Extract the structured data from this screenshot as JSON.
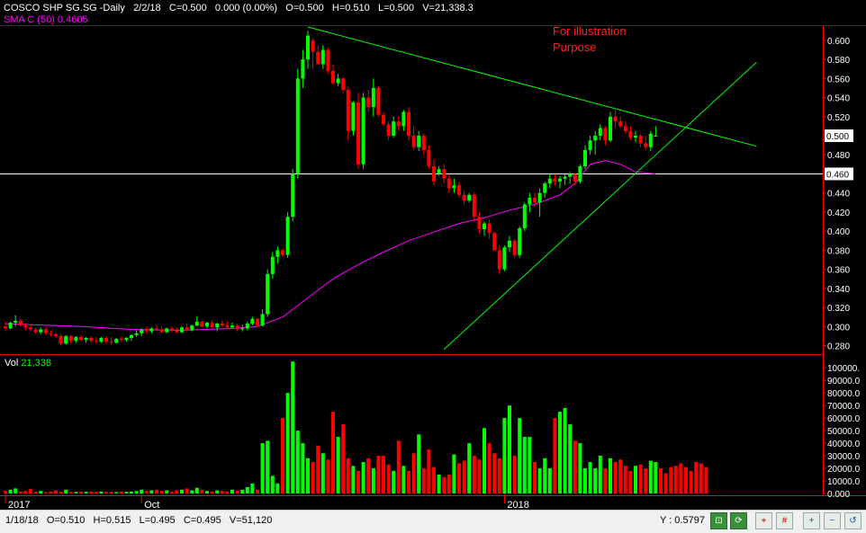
{
  "header": {
    "symbol": "COSCO SHP SG.SG -Daily",
    "date": "2/2/18",
    "close": "C=0.500",
    "change": "0.000 (0.00%)",
    "open": "O=0.500",
    "high": "H=0.510",
    "low": "L=0.500",
    "volume": "V=21,338.3"
  },
  "sma_label": "SMA C (50) 0.4605",
  "note": {
    "line1": "For illustration",
    "line2": "Purpose"
  },
  "volume_panel": {
    "label": "Vol",
    "value": "21,338"
  },
  "status": {
    "info": "1/18/18   O=0.510   H=0.515   L=0.495   C=0.495   V=51,120",
    "y_readout": "Y : 0.5797"
  },
  "colors": {
    "up": "#00ff00",
    "down": "#ff0000",
    "sma": "#ff00ff",
    "trendline": "#00ff00",
    "axis": "#ff0000",
    "hline": "#ffffff",
    "background": "#000000"
  },
  "toolbar_icons": [
    "zoom-fit-icon",
    "refresh-icon",
    "crosshair-icon",
    "grid-icon",
    "zoom-in-icon",
    "zoom-out-icon",
    "reset-icon"
  ],
  "chart_data": [
    {
      "type": "candlestick",
      "title": "COSCO SHP SG.SG -Daily",
      "price_axis_ticks": [
        "0.600",
        "0.580",
        "0.560",
        "0.540",
        "0.520",
        "0.500",
        "0.480",
        "0.460",
        "0.440",
        "0.420",
        "0.400",
        "0.380",
        "0.360",
        "0.340",
        "0.320",
        "0.300",
        "0.280"
      ],
      "ylim": [
        0.272,
        0.614
      ],
      "last_price_tag": "0.500",
      "hline_tag": "0.460",
      "hline_value": 0.46,
      "x_ticks": [
        {
          "i": 0,
          "label": "2017"
        },
        {
          "i": 27,
          "label": "Oct"
        },
        {
          "i": 99,
          "label": "2018"
        }
      ],
      "candles": [
        [
          0.3,
          0.305,
          0.295,
          0.298
        ],
        [
          0.298,
          0.305,
          0.297,
          0.304
        ],
        [
          0.304,
          0.312,
          0.3,
          0.306
        ],
        [
          0.306,
          0.308,
          0.3,
          0.301
        ],
        [
          0.301,
          0.303,
          0.296,
          0.299
        ],
        [
          0.299,
          0.302,
          0.295,
          0.297
        ],
        [
          0.297,
          0.299,
          0.292,
          0.294
        ],
        [
          0.294,
          0.299,
          0.292,
          0.297
        ],
        [
          0.297,
          0.299,
          0.291,
          0.293
        ],
        [
          0.293,
          0.296,
          0.29,
          0.292
        ],
        [
          0.292,
          0.293,
          0.288,
          0.29
        ],
        [
          0.29,
          0.292,
          0.28,
          0.282
        ],
        [
          0.282,
          0.291,
          0.281,
          0.29
        ],
        [
          0.29,
          0.291,
          0.282,
          0.285
        ],
        [
          0.285,
          0.29,
          0.283,
          0.289
        ],
        [
          0.289,
          0.291,
          0.284,
          0.286
        ],
        [
          0.286,
          0.289,
          0.283,
          0.288
        ],
        [
          0.288,
          0.29,
          0.283,
          0.285
        ],
        [
          0.285,
          0.289,
          0.282,
          0.284
        ],
        [
          0.284,
          0.289,
          0.283,
          0.288
        ],
        [
          0.288,
          0.29,
          0.282,
          0.284
        ],
        [
          0.284,
          0.289,
          0.281,
          0.283
        ],
        [
          0.283,
          0.288,
          0.282,
          0.287
        ],
        [
          0.287,
          0.29,
          0.284,
          0.286
        ],
        [
          0.286,
          0.289,
          0.284,
          0.288
        ],
        [
          0.288,
          0.292,
          0.285,
          0.291
        ],
        [
          0.291,
          0.296,
          0.289,
          0.293
        ],
        [
          0.293,
          0.298,
          0.29,
          0.297
        ],
        [
          0.297,
          0.3,
          0.292,
          0.295
        ],
        [
          0.295,
          0.299,
          0.293,
          0.298
        ],
        [
          0.298,
          0.302,
          0.295,
          0.297
        ],
        [
          0.297,
          0.3,
          0.293,
          0.294
        ],
        [
          0.294,
          0.299,
          0.293,
          0.298
        ],
        [
          0.298,
          0.3,
          0.294,
          0.296
        ],
        [
          0.296,
          0.299,
          0.293,
          0.294
        ],
        [
          0.294,
          0.3,
          0.293,
          0.299
        ],
        [
          0.299,
          0.303,
          0.295,
          0.296
        ],
        [
          0.296,
          0.302,
          0.295,
          0.301
        ],
        [
          0.301,
          0.311,
          0.3,
          0.305
        ],
        [
          0.305,
          0.306,
          0.299,
          0.3
        ],
        [
          0.3,
          0.305,
          0.298,
          0.304
        ],
        [
          0.304,
          0.307,
          0.298,
          0.299
        ],
        [
          0.299,
          0.304,
          0.295,
          0.303
        ],
        [
          0.303,
          0.306,
          0.299,
          0.301
        ],
        [
          0.301,
          0.305,
          0.297,
          0.299
        ],
        [
          0.299,
          0.304,
          0.298,
          0.301
        ],
        [
          0.301,
          0.303,
          0.295,
          0.297
        ],
        [
          0.297,
          0.302,
          0.295,
          0.298
        ],
        [
          0.298,
          0.305,
          0.296,
          0.303
        ],
        [
          0.303,
          0.31,
          0.301,
          0.308
        ],
        [
          0.308,
          0.309,
          0.299,
          0.301
        ],
        [
          0.301,
          0.318,
          0.3,
          0.313
        ],
        [
          0.313,
          0.36,
          0.31,
          0.355
        ],
        [
          0.355,
          0.378,
          0.35,
          0.373
        ],
        [
          0.373,
          0.384,
          0.366,
          0.38
        ],
        [
          0.38,
          0.382,
          0.373,
          0.375
        ],
        [
          0.375,
          0.42,
          0.372,
          0.415
        ],
        [
          0.415,
          0.465,
          0.41,
          0.46
        ],
        [
          0.46,
          0.57,
          0.455,
          0.56
        ],
        [
          0.56,
          0.59,
          0.55,
          0.58
        ],
        [
          0.58,
          0.61,
          0.57,
          0.605
        ],
        [
          0.6,
          0.603,
          0.57,
          0.588
        ],
        [
          0.588,
          0.594,
          0.575,
          0.575
        ],
        [
          0.575,
          0.595,
          0.57,
          0.59
        ],
        [
          0.59,
          0.592,
          0.565,
          0.568
        ],
        [
          0.568,
          0.575,
          0.553,
          0.555
        ],
        [
          0.555,
          0.565,
          0.552,
          0.56
        ],
        [
          0.56,
          0.562,
          0.545,
          0.548
        ],
        [
          0.548,
          0.551,
          0.495,
          0.505
        ],
        [
          0.505,
          0.536,
          0.5,
          0.535
        ],
        [
          0.535,
          0.545,
          0.465,
          0.47
        ],
        [
          0.47,
          0.545,
          0.465,
          0.54
        ],
        [
          0.54,
          0.548,
          0.525,
          0.53
        ],
        [
          0.53,
          0.56,
          0.52,
          0.55
        ],
        [
          0.55,
          0.552,
          0.52,
          0.522
        ],
        [
          0.522,
          0.525,
          0.51,
          0.512
        ],
        [
          0.512,
          0.515,
          0.495,
          0.5
        ],
        [
          0.5,
          0.52,
          0.498,
          0.515
        ],
        [
          0.515,
          0.52,
          0.505,
          0.51
        ],
        [
          0.51,
          0.527,
          0.505,
          0.525
        ],
        [
          0.525,
          0.53,
          0.495,
          0.5
        ],
        [
          0.5,
          0.51,
          0.485,
          0.488
        ],
        [
          0.488,
          0.505,
          0.484,
          0.5
        ],
        [
          0.5,
          0.502,
          0.48,
          0.485
        ],
        [
          0.485,
          0.49,
          0.465,
          0.468
        ],
        [
          0.468,
          0.475,
          0.448,
          0.452
        ],
        [
          0.46,
          0.468,
          0.458,
          0.465
        ],
        [
          0.465,
          0.47,
          0.45,
          0.455
        ],
        [
          0.455,
          0.46,
          0.44,
          0.445
        ],
        [
          0.445,
          0.455,
          0.44,
          0.448
        ],
        [
          0.448,
          0.452,
          0.435,
          0.438
        ],
        [
          0.438,
          0.442,
          0.428,
          0.432
        ],
        [
          0.432,
          0.44,
          0.43,
          0.438
        ],
        [
          0.438,
          0.44,
          0.41,
          0.415
        ],
        [
          0.415,
          0.42,
          0.398,
          0.402
        ],
        [
          0.402,
          0.41,
          0.395,
          0.408
        ],
        [
          0.408,
          0.412,
          0.392,
          0.398
        ],
        [
          0.398,
          0.4,
          0.378,
          0.38
        ],
        [
          0.38,
          0.385,
          0.355,
          0.36
        ],
        [
          0.36,
          0.385,
          0.358,
          0.383
        ],
        [
          0.383,
          0.395,
          0.378,
          0.39
        ],
        [
          0.39,
          0.392,
          0.372,
          0.375
        ],
        [
          0.375,
          0.405,
          0.372,
          0.403
        ],
        [
          0.403,
          0.43,
          0.4,
          0.428
        ],
        [
          0.428,
          0.44,
          0.42,
          0.435
        ],
        [
          0.435,
          0.44,
          0.425,
          0.43
        ],
        [
          0.43,
          0.445,
          0.415,
          0.44
        ],
        [
          0.44,
          0.452,
          0.435,
          0.45
        ],
        [
          0.45,
          0.46,
          0.445,
          0.455
        ],
        [
          0.455,
          0.46,
          0.448,
          0.452
        ],
        [
          0.452,
          0.458,
          0.445,
          0.455
        ],
        [
          0.455,
          0.46,
          0.448,
          0.457
        ],
        [
          0.457,
          0.462,
          0.45,
          0.46
        ],
        [
          0.46,
          0.46,
          0.448,
          0.452
        ],
        [
          0.452,
          0.47,
          0.45,
          0.468
        ],
        [
          0.468,
          0.49,
          0.465,
          0.485
        ],
        [
          0.485,
          0.5,
          0.48,
          0.495
        ],
        [
          0.495,
          0.505,
          0.48,
          0.5
        ],
        [
          0.5,
          0.512,
          0.495,
          0.508
        ],
        [
          0.508,
          0.51,
          0.49,
          0.495
        ],
        [
          0.495,
          0.525,
          0.493,
          0.52
        ],
        [
          0.52,
          0.527,
          0.508,
          0.515
        ],
        [
          0.515,
          0.52,
          0.508,
          0.51
        ],
        [
          0.51,
          0.515,
          0.502,
          0.505
        ],
        [
          0.505,
          0.51,
          0.495,
          0.498
        ],
        [
          0.498,
          0.505,
          0.493,
          0.5
        ],
        [
          0.5,
          0.502,
          0.488,
          0.492
        ],
        [
          0.492,
          0.5,
          0.485,
          0.488
        ],
        [
          0.488,
          0.505,
          0.484,
          0.502
        ],
        [
          0.5,
          0.51,
          0.5,
          0.5
        ]
      ],
      "sma50": [
        [
          0,
          0.303
        ],
        [
          15,
          0.3
        ],
        [
          25,
          0.297
        ],
        [
          35,
          0.296
        ],
        [
          45,
          0.298
        ],
        [
          50,
          0.3
        ],
        [
          55,
          0.31
        ],
        [
          60,
          0.33
        ],
        [
          65,
          0.35
        ],
        [
          70,
          0.365
        ],
        [
          75,
          0.378
        ],
        [
          80,
          0.39
        ],
        [
          85,
          0.399
        ],
        [
          90,
          0.408
        ],
        [
          95,
          0.414
        ],
        [
          100,
          0.422
        ],
        [
          105,
          0.428
        ],
        [
          110,
          0.438
        ],
        [
          113,
          0.45
        ],
        [
          116,
          0.47
        ],
        [
          119,
          0.474
        ],
        [
          122,
          0.47
        ],
        [
          125,
          0.462
        ],
        [
          129,
          0.46
        ]
      ],
      "trendlines": [
        {
          "x1": 60,
          "y1": 0.614,
          "x2": 149,
          "y2": 0.489
        },
        {
          "x1": 87,
          "y1": 0.276,
          "x2": 149,
          "y2": 0.577
        }
      ]
    },
    {
      "type": "bar",
      "title": "Vol",
      "ylim": [
        0,
        108000
      ],
      "volume_axis_ticks": [
        "100000.",
        "90000.0",
        "80000.0",
        "70000.0",
        "60000.0",
        "50000.0",
        "40000.0",
        "30000.0",
        "20000.0",
        "10000.0",
        "0.000"
      ],
      "values": [
        2000,
        3000,
        4000,
        1500,
        2000,
        3500,
        1500,
        2000,
        1000,
        1500,
        2500,
        1500,
        3000,
        1200,
        1200,
        1400,
        1300,
        1500,
        1200,
        1600,
        1200,
        1300,
        1000,
        1600,
        1300,
        1500,
        2000,
        3000,
        2000,
        2500,
        3000,
        2000,
        2500,
        1500,
        2500,
        3000,
        4000,
        2500,
        4500,
        3000,
        2000,
        1500,
        2500,
        2000,
        1500,
        3000,
        2000,
        3000,
        5000,
        8000,
        3000,
        40000,
        42000,
        14000,
        8000,
        60000,
        80000,
        105000,
        50000,
        40000,
        28000,
        25000,
        38000,
        32000,
        27000,
        65000,
        45000,
        55000,
        28000,
        22000,
        18000,
        25000,
        28000,
        20000,
        30000,
        30000,
        23000,
        18000,
        42000,
        22000,
        18000,
        32000,
        47000,
        20000,
        35000,
        21000,
        15000,
        13000,
        15000,
        31000,
        24000,
        26000,
        40000,
        30000,
        27000,
        52000,
        40000,
        32000,
        28000,
        60000,
        70000,
        30000,
        60000,
        45000,
        45000,
        25000,
        20000,
        28000,
        20000,
        60000,
        65000,
        68000,
        55000,
        42000,
        40000,
        20000,
        25000,
        20000,
        30000,
        20000,
        28000,
        25000,
        27000,
        22000,
        18000,
        22000,
        23000,
        20000,
        26000,
        25000,
        20000,
        16000,
        21000,
        22000,
        24000,
        21000,
        18000,
        25000,
        24000,
        21000
      ]
    }
  ]
}
